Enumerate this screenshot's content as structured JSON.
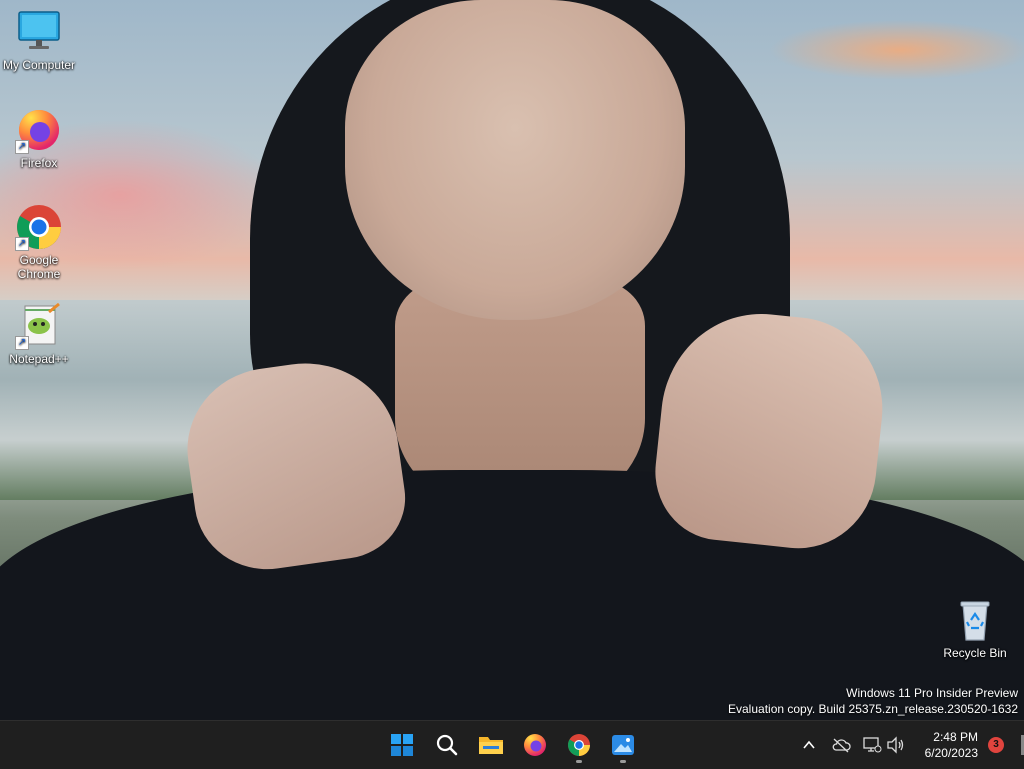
{
  "desktop": {
    "icons": [
      {
        "label": "My Computer"
      },
      {
        "label": "Firefox"
      },
      {
        "label": "Google Chrome"
      },
      {
        "label": "Notepad++"
      },
      {
        "label": "Recycle Bin"
      }
    ]
  },
  "watermark": {
    "line1": "Windows 11 Pro Insider Preview",
    "line2": "Evaluation copy. Build 25375.zn_release.230520-1632"
  },
  "taskbar": {
    "pinned": [
      "start-icon",
      "search-icon",
      "file-explorer-icon",
      "firefox-icon",
      "chrome-icon",
      "photos-icon"
    ],
    "clock": {
      "time": "2:48 PM",
      "date": "6/20/2023"
    },
    "notification_count": "3"
  },
  "colors": {
    "taskbar": "#1f1f1f",
    "badge": "#e0443e",
    "accent_blue": "#1a8ae8"
  }
}
